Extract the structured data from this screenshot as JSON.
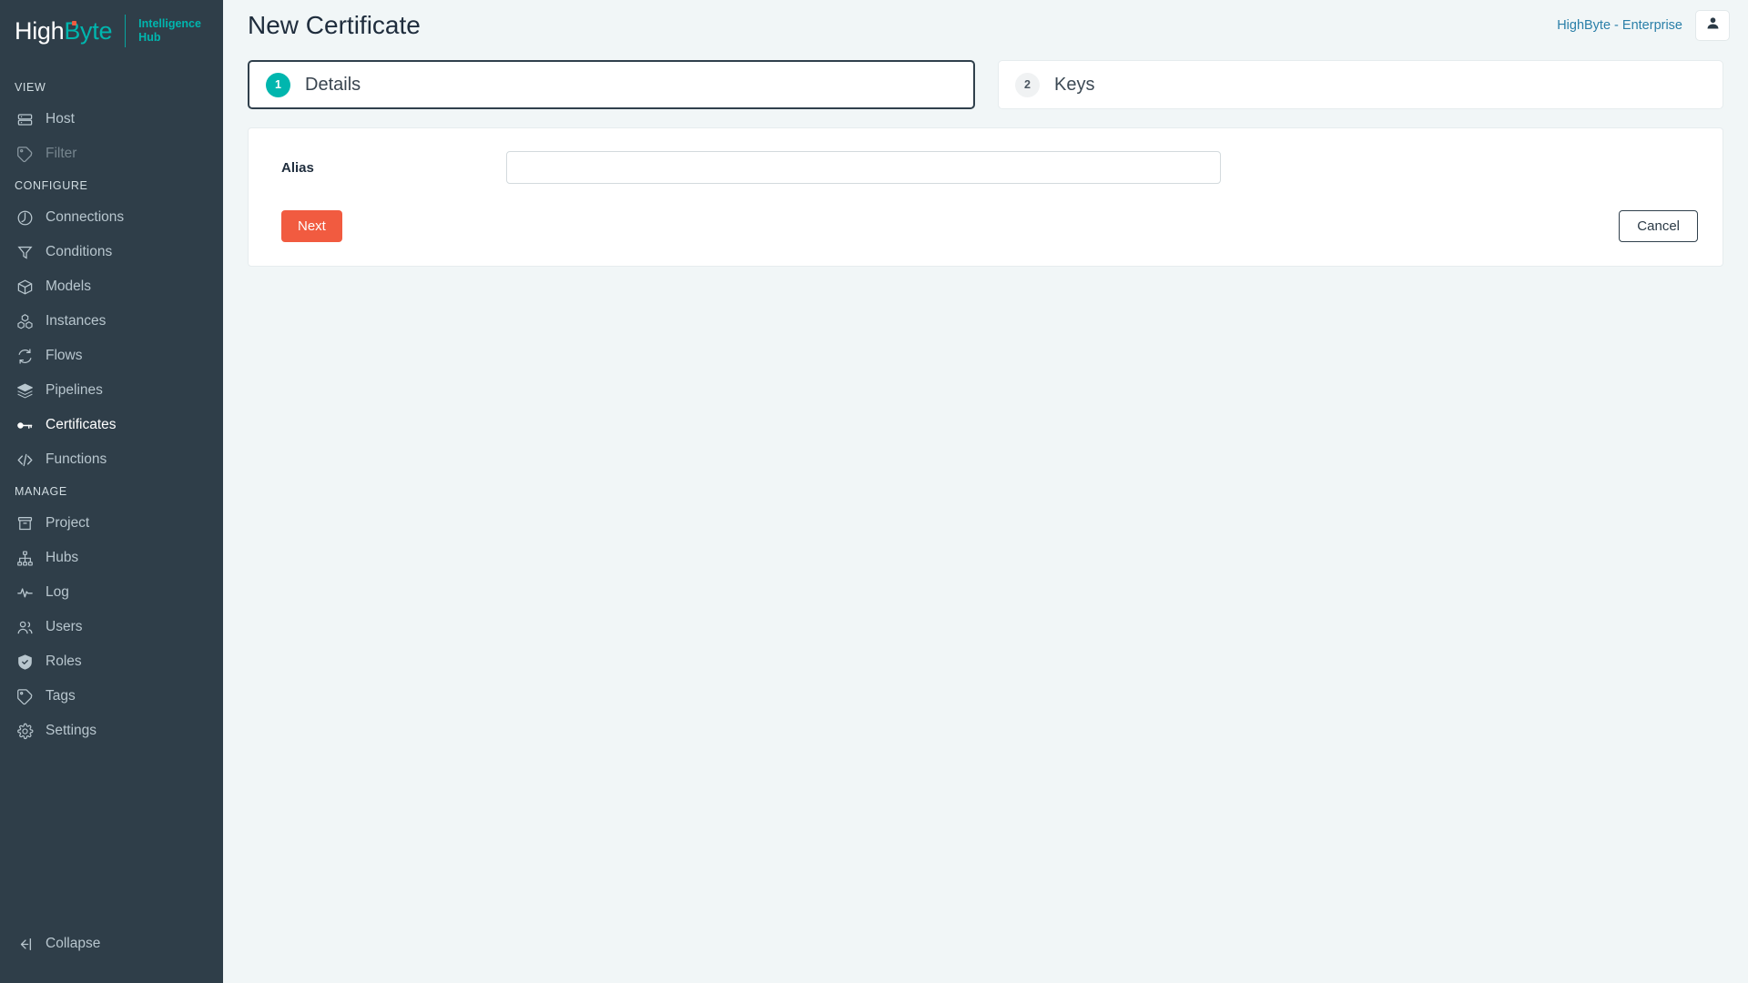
{
  "brand": {
    "name_part1": "High",
    "name_part2": "Byte",
    "subtitle_line1": "Intelligence",
    "subtitle_line2": "Hub",
    "accent_teal": "#00b6ae",
    "accent_orange": "#f15b40",
    "sidebar_bg": "#2f3e49"
  },
  "sidebar": {
    "sections": [
      {
        "label": "VIEW",
        "items": [
          {
            "label": "Host",
            "icon": "server-icon",
            "state": "normal"
          },
          {
            "label": "Filter",
            "icon": "tag-icon",
            "state": "disabled"
          }
        ]
      },
      {
        "label": "CONFIGURE",
        "items": [
          {
            "label": "Connections",
            "icon": "plug-icon",
            "state": "normal"
          },
          {
            "label": "Conditions",
            "icon": "funnel-icon",
            "state": "normal"
          },
          {
            "label": "Models",
            "icon": "box-icon",
            "state": "normal"
          },
          {
            "label": "Instances",
            "icon": "cubes-icon",
            "state": "normal"
          },
          {
            "label": "Flows",
            "icon": "refresh-icon",
            "state": "normal"
          },
          {
            "label": "Pipelines",
            "icon": "layers-icon",
            "state": "normal"
          },
          {
            "label": "Certificates",
            "icon": "key-icon",
            "state": "active"
          },
          {
            "label": "Functions",
            "icon": "code-icon",
            "state": "normal"
          }
        ]
      },
      {
        "label": "MANAGE",
        "items": [
          {
            "label": "Project",
            "icon": "archive-icon",
            "state": "normal"
          },
          {
            "label": "Hubs",
            "icon": "sitemap-icon",
            "state": "normal"
          },
          {
            "label": "Log",
            "icon": "activity-icon",
            "state": "normal"
          },
          {
            "label": "Users",
            "icon": "users-icon",
            "state": "normal"
          },
          {
            "label": "Roles",
            "icon": "shield-check-icon",
            "state": "normal"
          },
          {
            "label": "Tags",
            "icon": "tag-icon",
            "state": "normal"
          },
          {
            "label": "Settings",
            "icon": "gear-icon",
            "state": "normal"
          }
        ]
      }
    ],
    "collapse": {
      "label": "Collapse",
      "icon": "collapse-left-icon"
    }
  },
  "header": {
    "title": "New Certificate",
    "tenant": "HighByte - Enterprise",
    "avatar_icon": "user-icon"
  },
  "wizard": {
    "steps": [
      {
        "number": "1",
        "label": "Details",
        "state": "active"
      },
      {
        "number": "2",
        "label": "Keys",
        "state": "inactive"
      }
    ]
  },
  "form": {
    "fields": [
      {
        "label": "Alias",
        "value": "",
        "placeholder": ""
      }
    ]
  },
  "buttons": {
    "next": "Next",
    "cancel": "Cancel"
  }
}
